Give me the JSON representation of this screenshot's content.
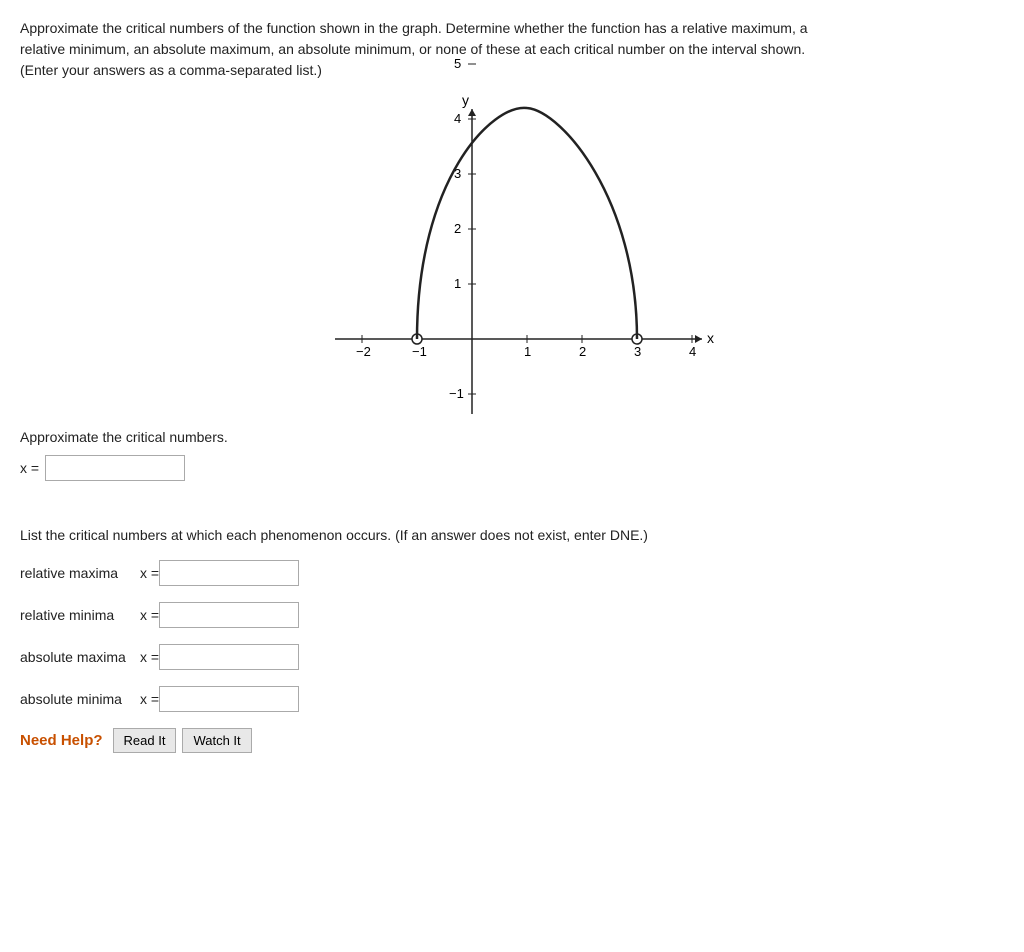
{
  "instructions": {
    "line1": "Approximate the critical numbers of the function shown in the graph. Determine whether the function has a relative maximum, a",
    "line2": "relative minimum, an absolute maximum, an absolute minimum, or none of these at each critical number on the interval shown.",
    "line3": "(Enter your answers as a comma-separated list.)"
  },
  "graph": {
    "x_axis_label": "x",
    "y_axis_label": "y",
    "x_ticks": [
      "-2",
      "-1",
      "1",
      "2",
      "3",
      "4"
    ],
    "y_ticks": [
      "-1",
      "1",
      "2",
      "3",
      "4",
      "5"
    ]
  },
  "approximate_section": {
    "label": "Approximate the critical numbers.",
    "x_label": "x =",
    "input_placeholder": ""
  },
  "list_section": {
    "label": "List the critical numbers at which each phenomenon occurs. (If an answer does not exist, enter DNE.)"
  },
  "phenomena": [
    {
      "id": "relative-maxima",
      "label": "relative maxima",
      "x_label": "x ="
    },
    {
      "id": "relative-minima",
      "label": "relative minima",
      "x_label": "x ="
    },
    {
      "id": "absolute-maxima",
      "label": "absolute maxima",
      "x_label": "x ="
    },
    {
      "id": "absolute-minima",
      "label": "absolute minima",
      "x_label": "x ="
    }
  ],
  "help": {
    "label": "Need Help?",
    "read_it": "Read It",
    "watch_it": "Watch It"
  }
}
